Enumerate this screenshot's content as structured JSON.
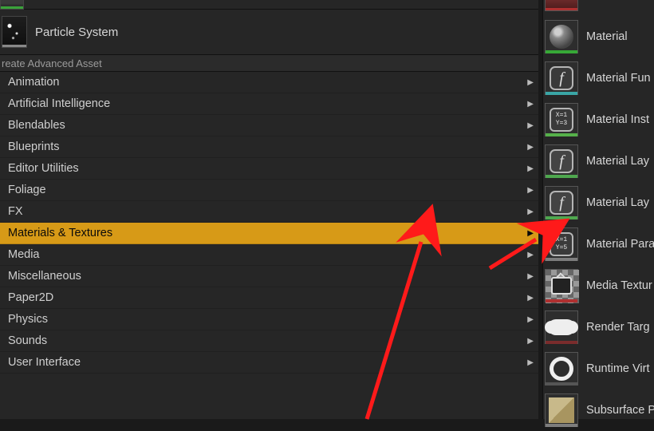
{
  "basic_asset": {
    "label": "Particle System"
  },
  "section_header": "reate Advanced Asset",
  "categories": [
    {
      "label": "Animation"
    },
    {
      "label": "Artificial Intelligence"
    },
    {
      "label": "Blendables"
    },
    {
      "label": "Blueprints"
    },
    {
      "label": "Editor Utilities"
    },
    {
      "label": "Foliage"
    },
    {
      "label": "FX"
    },
    {
      "label": "Materials & Textures",
      "selected": true
    },
    {
      "label": "Media"
    },
    {
      "label": "Miscellaneous"
    },
    {
      "label": "Paper2D"
    },
    {
      "label": "Physics"
    },
    {
      "label": "Sounds"
    },
    {
      "label": "User Interface"
    }
  ],
  "submenu": [
    {
      "label": "Material",
      "icon": "sphere",
      "accent": "green"
    },
    {
      "label": "Material Fun",
      "icon": "fn",
      "accent": "teal"
    },
    {
      "label": "Material Inst",
      "icon": "xy13",
      "accent": "lime"
    },
    {
      "label": "Material Lay",
      "icon": "fnvar",
      "accent": "verde"
    },
    {
      "label": "Material Lay",
      "icon": "fnvar",
      "accent": "verde"
    },
    {
      "label": "Material Para",
      "icon": "xy15",
      "accent": "gray"
    },
    {
      "label": "Media Textur",
      "icon": "tv",
      "accent": "red",
      "checker": true
    },
    {
      "label": "Render Targ",
      "icon": "cloud",
      "accent": "maroon"
    },
    {
      "label": "Runtime Virt",
      "icon": "ring",
      "accent": "dark"
    },
    {
      "label": "Subsurface P",
      "icon": "fold",
      "accent": "gray"
    }
  ],
  "xy13": {
    "l1": "X=1",
    "l2": "Y=3"
  },
  "xy15": {
    "l1": "X=1",
    "l2": "Y=5"
  }
}
